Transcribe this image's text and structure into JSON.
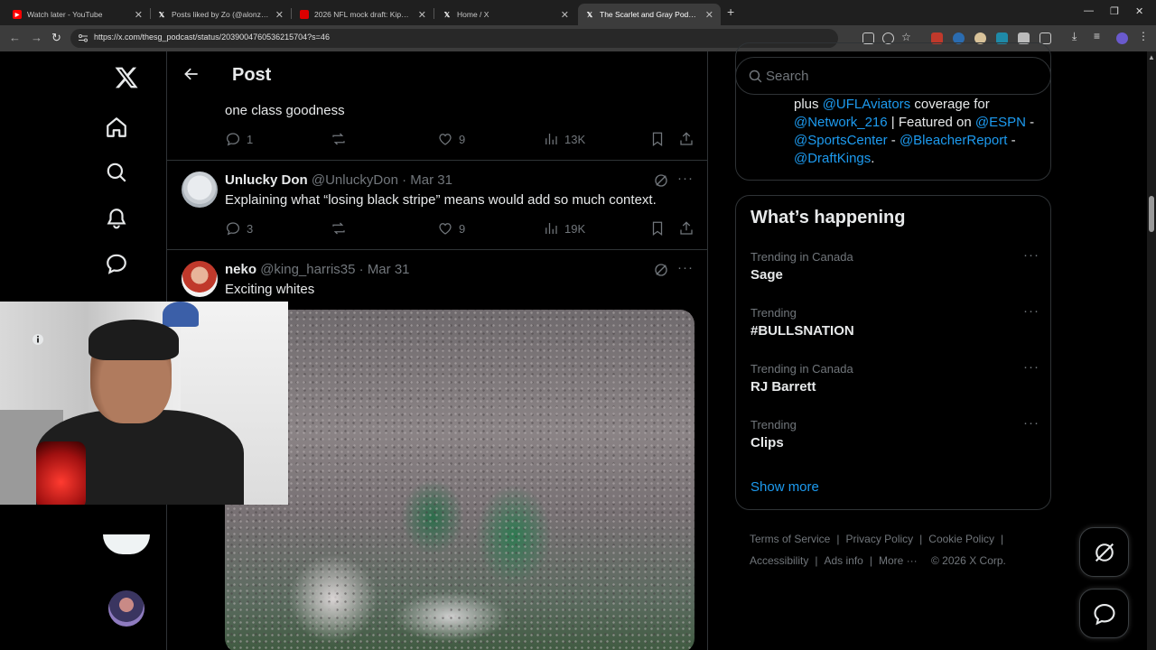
{
  "browser": {
    "tabs": [
      {
        "label": "Watch later - YouTube",
        "icon": "youtube-icon",
        "active": false
      },
      {
        "label": "Posts liked by Zo (@alonzonem",
        "icon": "x-logo-icon",
        "active": false
      },
      {
        "label": "2026 NFL mock draft: Kiper's p",
        "icon": "espn-icon",
        "active": false
      },
      {
        "label": "Home / X",
        "icon": "x-logo-icon",
        "active": false
      },
      {
        "label": "The Scarlet and Gray Podcast o",
        "icon": "x-logo-icon",
        "active": true
      }
    ],
    "url": "https://x.com/thesg_podcast/status/2039004760536215704?s=46"
  },
  "header": {
    "title": "Post"
  },
  "previous_post": {
    "text_tail": "one class goodness",
    "stats": {
      "replies": "1",
      "likes": "9",
      "views": "13K"
    }
  },
  "replies": [
    {
      "name": "Unlucky Don",
      "handle": "@UnluckyDon",
      "date": "Mar 31",
      "text": "Explaining what “losing black stripe” means would add so much context.",
      "stats": {
        "replies": "3",
        "likes": "9",
        "views": "19K"
      }
    },
    {
      "name": "neko",
      "handle": "@king_harris35",
      "date": "Mar 31",
      "text": "Exciting whites"
    }
  ],
  "separator": "·",
  "search": {
    "placeholder": "Search"
  },
  "bio": {
    "prefix": "plus",
    "m1": "@UFLAviators",
    "t1": "coverage for",
    "m2": "@Network_216",
    "t2": "| Featured on",
    "m3": "@ESPN",
    "t3": "-",
    "m4": "@SportsCenter",
    "t4": "-",
    "m5": "@BleacherReport",
    "t5": "-",
    "m6": "@DraftKings",
    "t6": "."
  },
  "trends": {
    "title": "What’s happening",
    "items": [
      {
        "context": "Trending in Canada",
        "name": "Sage"
      },
      {
        "context": "Trending",
        "name": "#BULLSNATION"
      },
      {
        "context": "Trending in Canada",
        "name": "RJ Barrett"
      },
      {
        "context": "Trending",
        "name": "Clips"
      }
    ],
    "show_more": "Show more"
  },
  "footer": {
    "terms": "Terms of Service",
    "privacy": "Privacy Policy",
    "cookie": "Cookie Policy",
    "accessibility": "Accessibility",
    "ads": "Ads info",
    "more": "More ···",
    "copyright": "© 2026 X Corp.",
    "sep": "|"
  },
  "colors": {
    "accent": "#1d9bf0",
    "muted": "#71767b",
    "border": "#2f3336",
    "text": "#e7e9ea"
  }
}
